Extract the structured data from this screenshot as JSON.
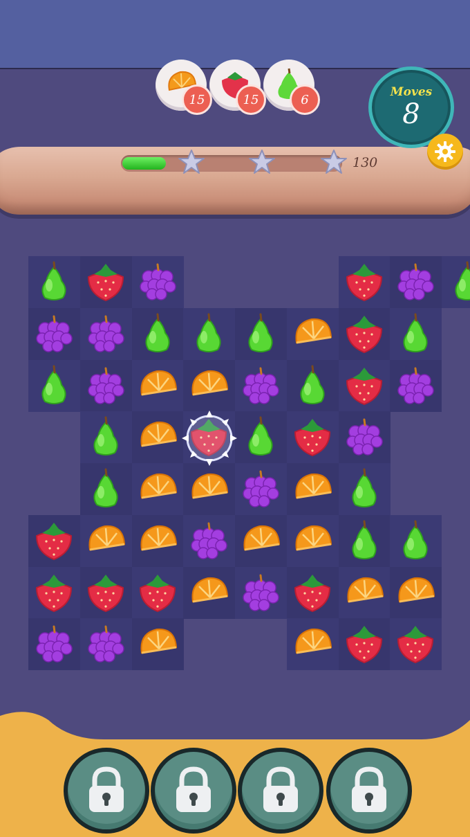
{
  "goals": [
    {
      "icon": "orange-icon",
      "count": "15"
    },
    {
      "icon": "strawberry-icon",
      "count": "15"
    },
    {
      "icon": "pear-icon",
      "count": "6"
    }
  ],
  "moves": {
    "label": "Moves",
    "value": "8"
  },
  "progress": {
    "fraction": 0.2,
    "stars": 3,
    "score": "130"
  },
  "board": {
    "rows": [
      "PSG---SGP",
      "GGPPPOSP",
      "PGOOGPSG",
      "-POSPSG-",
      "-POOGOP-",
      "SOOGOOPP",
      "SSSOGSOO",
      "GGO--OSS"
    ],
    "legend": {
      "P": "pear",
      "S": "strawberry",
      "G": "grape",
      "O": "orange",
      "-": "empty"
    },
    "special_cell": {
      "row": 3,
      "col": 3,
      "fruit": "strawberry",
      "effect": "spiked-bubble"
    }
  },
  "boosters": [
    {
      "icon": "lock-icon",
      "locked": true
    },
    {
      "icon": "lock-icon",
      "locked": true
    },
    {
      "icon": "lock-icon",
      "locked": true
    },
    {
      "icon": "lock-icon",
      "locked": true
    }
  ],
  "colors": {
    "board_bg": "#4f4a7e",
    "footer": "#eeb24a",
    "moves_ring": "#3fb6b8",
    "gear": "#f6b81c"
  }
}
